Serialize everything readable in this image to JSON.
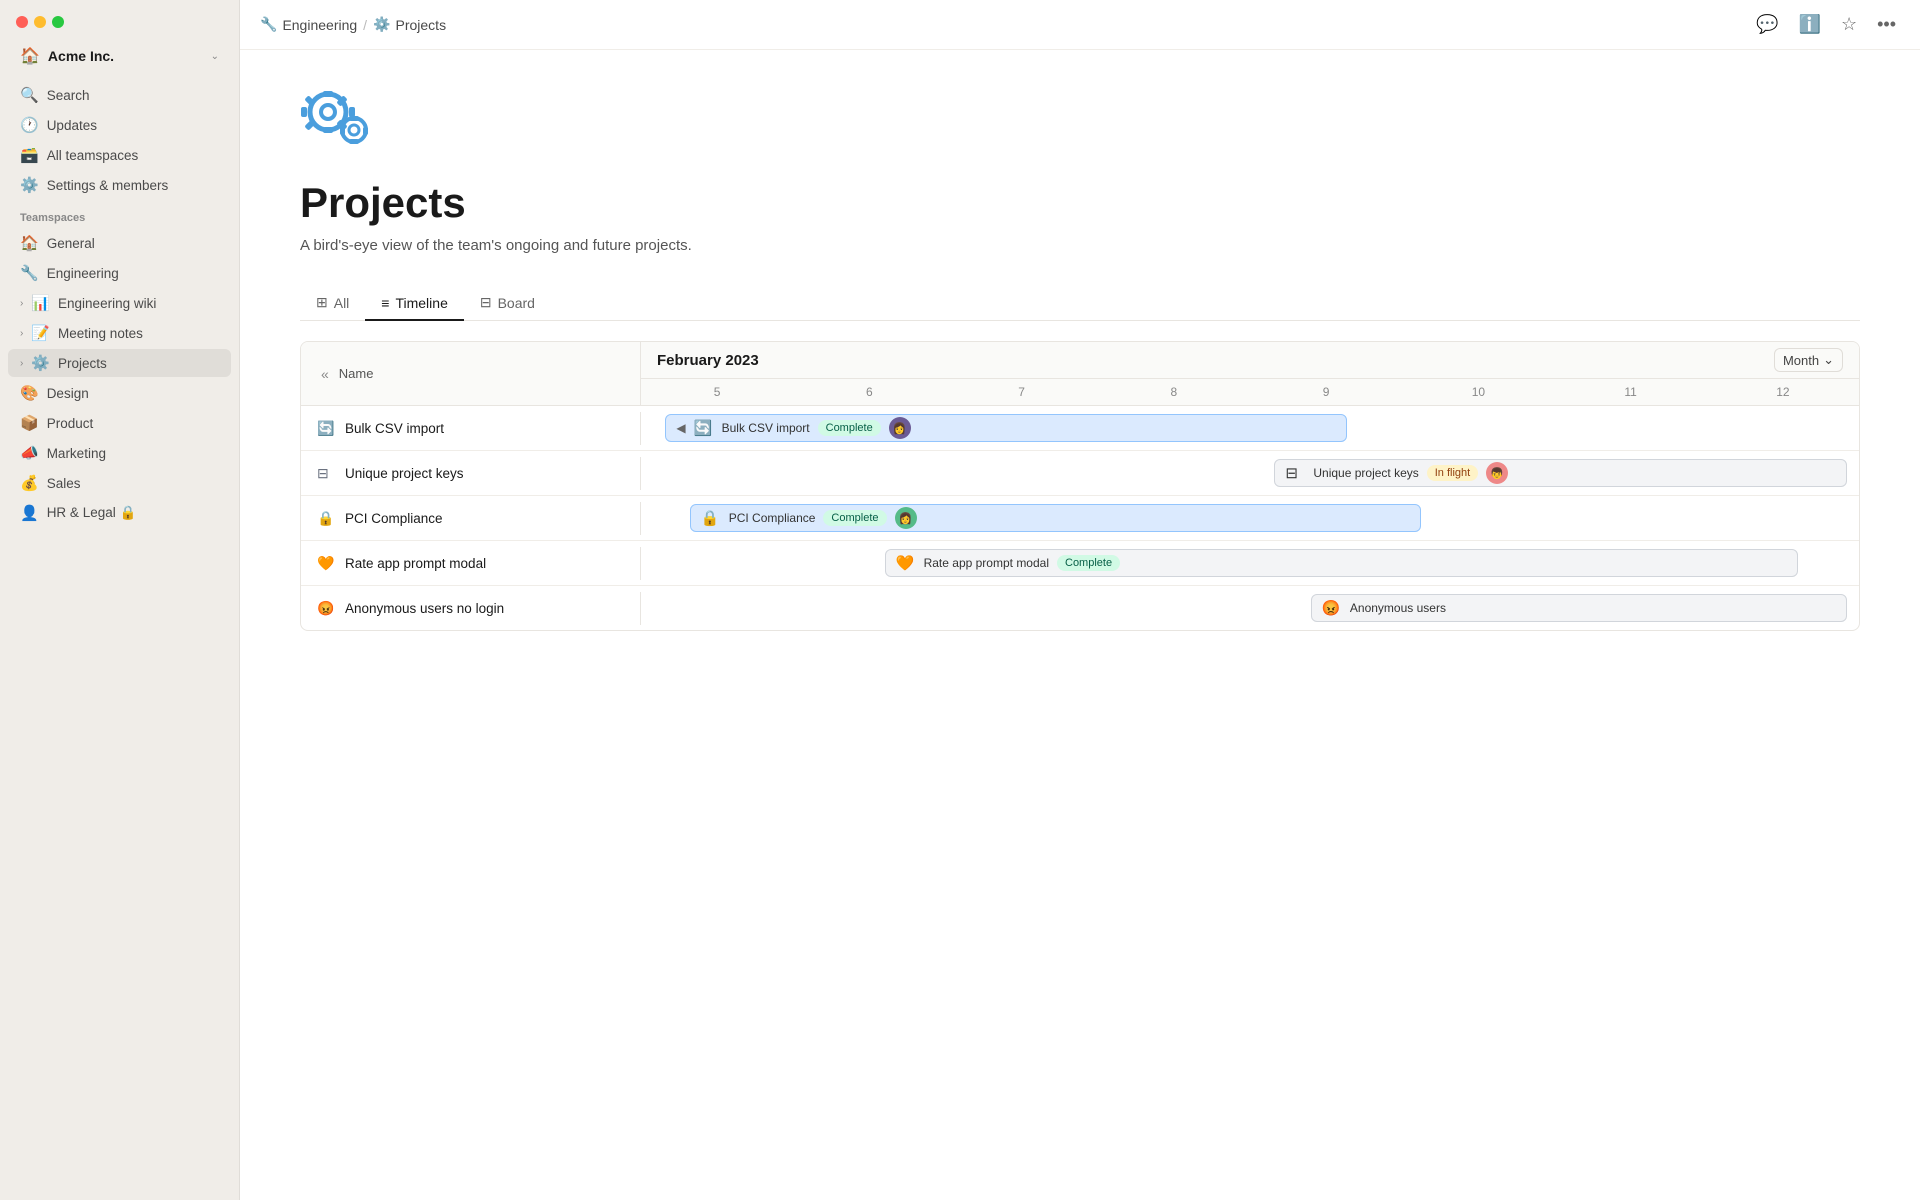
{
  "window": {
    "title": "Projects"
  },
  "sidebar": {
    "workspace_name": "Acme Inc.",
    "workspace_icon": "🏠",
    "nav_items": [
      {
        "id": "search",
        "icon": "🔍",
        "label": "Search",
        "active": false
      },
      {
        "id": "updates",
        "icon": "🕐",
        "label": "Updates",
        "active": false
      },
      {
        "id": "all-teamspaces",
        "icon": "🗃️",
        "label": "All teamspaces",
        "active": false
      },
      {
        "id": "settings",
        "icon": "⚙️",
        "label": "Settings & members",
        "active": false
      }
    ],
    "teamspaces_label": "Teamspaces",
    "teamspace_items": [
      {
        "id": "general",
        "icon": "🏠",
        "label": "General",
        "has_chevron": false
      },
      {
        "id": "engineering",
        "icon": "🔧",
        "label": "Engineering",
        "has_chevron": false
      },
      {
        "id": "engineering-wiki",
        "icon": "📊",
        "label": "Engineering wiki",
        "has_chevron": true
      },
      {
        "id": "meeting-notes",
        "icon": "📝",
        "label": "Meeting notes",
        "has_chevron": true
      },
      {
        "id": "projects",
        "icon": "⚙️",
        "label": "Projects",
        "has_chevron": true,
        "active": true
      },
      {
        "id": "design",
        "icon": "🎨",
        "label": "Design",
        "has_chevron": false
      },
      {
        "id": "product",
        "icon": "📦",
        "label": "Product",
        "has_chevron": false
      },
      {
        "id": "marketing",
        "icon": "📣",
        "label": "Marketing",
        "has_chevron": false
      },
      {
        "id": "sales",
        "icon": "💰",
        "label": "Sales",
        "has_chevron": false
      },
      {
        "id": "hr-legal",
        "icon": "👤",
        "label": "HR & Legal 🔒",
        "has_chevron": false
      }
    ]
  },
  "topbar": {
    "breadcrumb": [
      {
        "icon": "🔧",
        "label": "Engineering"
      },
      {
        "icon": "⚙️",
        "label": "Projects"
      }
    ],
    "action_icons": [
      "💬",
      "ℹ️",
      "⭐",
      "•••"
    ]
  },
  "page": {
    "icon": "⚙️",
    "title": "Projects",
    "description": "A bird's-eye view of the team's ongoing and future projects.",
    "tabs": [
      {
        "id": "all",
        "icon": "⊞",
        "label": "All",
        "active": false
      },
      {
        "id": "timeline",
        "icon": "≡",
        "label": "Timeline",
        "active": true
      },
      {
        "id": "board",
        "icon": "⊟",
        "label": "Board",
        "active": false
      }
    ],
    "timeline": {
      "month_label": "February 2023",
      "month_selector": "Month",
      "name_col_label": "Name",
      "days": [
        "5",
        "6",
        "7",
        "8",
        "9",
        "10",
        "11",
        "12"
      ],
      "rows": [
        {
          "id": "bulk-csv",
          "icon": "🔄",
          "name": "Bulk CSV import",
          "bar_label": "Bulk CSV import",
          "status": "Complete",
          "status_type": "complete",
          "has_avatar": true,
          "bar_left_pct": 2,
          "bar_width_pct": 55
        },
        {
          "id": "unique-keys",
          "icon": "⊟",
          "name": "Unique project keys",
          "bar_label": "Unique project keys",
          "status": "In flight",
          "status_type": "inflight",
          "has_avatar": true,
          "bar_left_pct": 50,
          "bar_width_pct": 48
        },
        {
          "id": "pci",
          "icon": "🔒",
          "name": "PCI Compliance",
          "bar_label": "PCI Compliance",
          "status": "Complete",
          "status_type": "complete",
          "has_avatar": true,
          "bar_left_pct": 5,
          "bar_width_pct": 60
        },
        {
          "id": "rate-app",
          "icon": "🧡",
          "name": "Rate app prompt modal",
          "bar_label": "Rate app prompt modal",
          "status": "Complete",
          "status_type": "complete",
          "has_avatar": false,
          "bar_left_pct": 20,
          "bar_width_pct": 72
        },
        {
          "id": "anon-users",
          "icon": "😡",
          "name": "Anonymous users no login",
          "bar_label": "Anonymous users",
          "status": "",
          "status_type": "",
          "has_avatar": false,
          "bar_left_pct": 55,
          "bar_width_pct": 44
        }
      ]
    }
  }
}
